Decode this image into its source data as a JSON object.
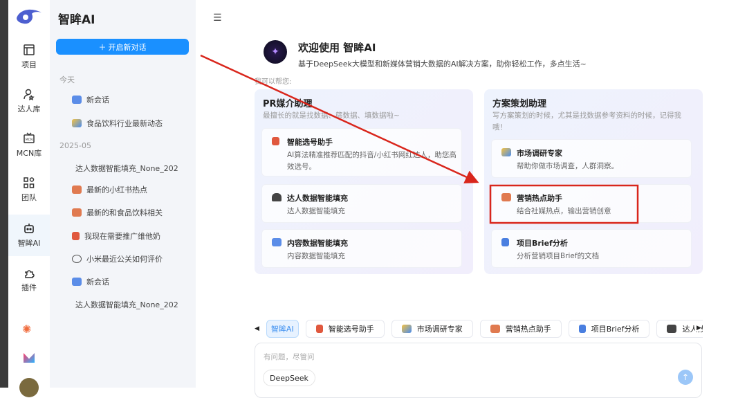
{
  "rail": {
    "items": [
      {
        "label": "项目",
        "icon": "layout-icon"
      },
      {
        "label": "达人库",
        "icon": "user-star-icon"
      },
      {
        "label": "MCN库",
        "icon": "tv-icon"
      },
      {
        "label": "团队",
        "icon": "apps-icon"
      },
      {
        "label": "智眸AI",
        "icon": "robot-icon"
      },
      {
        "label": "插件",
        "icon": "puzzle-icon"
      }
    ]
  },
  "sidebar": {
    "title": "智眸AI",
    "new_chat": "＋ 开启新对话",
    "groups": [
      {
        "label": "今天"
      },
      {
        "label": "2025-05"
      }
    ],
    "history": [
      "新会话",
      "食品饮料行业最新动态",
      "达人数据智能填充_None_202",
      "最新的小红书热点",
      "最新的和食品饮料相关",
      "我现在需要推广维他奶",
      "小米最近公关如何评价",
      "新会话",
      "达人数据智能填充_None_202"
    ]
  },
  "main": {
    "menu_icon": "☰",
    "welcome": "欢迎使用 智眸AI",
    "subtitle": "基于DeepSeek大模型和新媒体营销大数据的AI解决方案，助你轻松工作，多点生活~",
    "help": "我可以帮您:",
    "panels": [
      {
        "title": "PR媒介助理",
        "desc": "最擅长的就是找数据、筛数据、填数据啦~",
        "cards": [
          {
            "title": "智能选号助手",
            "desc": "AI算法精准推荐匹配的抖音/小红书网红达人，助您高效选号。"
          },
          {
            "title": "达人数据智能填充",
            "desc": "达人数据智能填充"
          },
          {
            "title": "内容数据智能填充",
            "desc": "内容数据智能填充"
          }
        ]
      },
      {
        "title": "方案策划助理",
        "desc": "写方案策划的时候，尤其是找数据参考资料的时候，记得我哦！",
        "cards": [
          {
            "title": "市场调研专家",
            "desc": "帮助你做市场调查，人群洞察。"
          },
          {
            "title": "营销热点助手",
            "desc": "结合社媒热点，输出营销创意"
          },
          {
            "title": "项目Brief分析",
            "desc": "分析营销项目Brief的文档"
          }
        ]
      }
    ],
    "tabs": [
      "智眸AI",
      "智能选号助手",
      "市场调研专家",
      "营销热点助手",
      "项目Brief分析",
      "达人数据智能填充"
    ],
    "input": {
      "placeholder": "有问题，尽管问",
      "model": "DeepSeek",
      "send": "↑"
    }
  },
  "colors": {
    "accent": "#1a90ff",
    "annotation": "#d9261c"
  }
}
